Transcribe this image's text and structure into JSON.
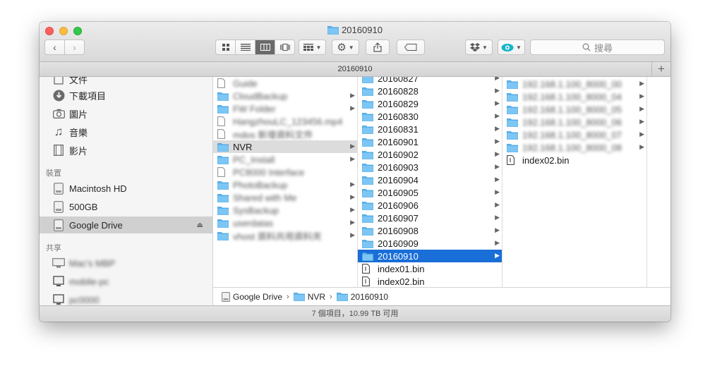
{
  "window": {
    "title": "20160910"
  },
  "toolbar": {
    "search_placeholder": "搜尋"
  },
  "pathbar": {
    "title": "20160910"
  },
  "sidebar": {
    "items_top": [
      {
        "label": "文件",
        "icon": "document-icon"
      },
      {
        "label": "下載項目",
        "icon": "download-icon"
      },
      {
        "label": "圖片",
        "icon": "camera-icon"
      },
      {
        "label": "音樂",
        "icon": "music-note-icon"
      },
      {
        "label": "影片",
        "icon": "film-icon"
      }
    ],
    "devices_header": "裝置",
    "devices": [
      {
        "label": "Macintosh HD",
        "icon": "harddisk-icon"
      },
      {
        "label": "500GB",
        "icon": "harddisk-icon"
      },
      {
        "label": "Google Drive",
        "icon": "harddisk-icon"
      }
    ],
    "shared_header": "共享",
    "shared": [
      {
        "label": "Mac's MBP"
      },
      {
        "label": "mobile-pc"
      },
      {
        "label": "pc0000"
      }
    ]
  },
  "columns": {
    "col1": [
      {
        "label": "Guide",
        "folder": false,
        "arrow": false
      },
      {
        "label": "CloudBackup",
        "folder": true,
        "arrow": true
      },
      {
        "label": "FW Folder",
        "folder": true,
        "arrow": true
      },
      {
        "label": "HangzhouLC_123456.mp4",
        "folder": false,
        "arrow": false
      },
      {
        "label": "mdos 新增資料文件",
        "folder": false,
        "arrow": false
      },
      {
        "label": "NVR",
        "folder": true,
        "arrow": true
      },
      {
        "label": "PC_Install",
        "folder": true,
        "arrow": true
      },
      {
        "label": "PC8000 Interface",
        "folder": false,
        "arrow": false
      },
      {
        "label": "PhotoBackup",
        "folder": true,
        "arrow": true
      },
      {
        "label": "Shared with Me",
        "folder": true,
        "arrow": true
      },
      {
        "label": "SysBackup",
        "folder": true,
        "arrow": true
      },
      {
        "label": "userdatas",
        "folder": true,
        "arrow": true
      },
      {
        "label": "vhost 資料共用資料夾",
        "folder": true,
        "arrow": true
      }
    ],
    "col2": [
      {
        "label": "20160827",
        "folder": true,
        "arrow": true
      },
      {
        "label": "20160828",
        "folder": true,
        "arrow": true
      },
      {
        "label": "20160829",
        "folder": true,
        "arrow": true
      },
      {
        "label": "20160830",
        "folder": true,
        "arrow": true
      },
      {
        "label": "20160831",
        "folder": true,
        "arrow": true
      },
      {
        "label": "20160901",
        "folder": true,
        "arrow": true
      },
      {
        "label": "20160902",
        "folder": true,
        "arrow": true
      },
      {
        "label": "20160903",
        "folder": true,
        "arrow": true
      },
      {
        "label": "20160904",
        "folder": true,
        "arrow": true
      },
      {
        "label": "20160905",
        "folder": true,
        "arrow": true
      },
      {
        "label": "20160906",
        "folder": true,
        "arrow": true
      },
      {
        "label": "20160907",
        "folder": true,
        "arrow": true
      },
      {
        "label": "20160908",
        "folder": true,
        "arrow": true
      },
      {
        "label": "20160909",
        "folder": true,
        "arrow": true
      },
      {
        "label": "20160910",
        "folder": true,
        "arrow": true
      },
      {
        "label": "index01.bin",
        "folder": false,
        "arrow": false
      },
      {
        "label": "index02.bin",
        "folder": false,
        "arrow": false
      }
    ],
    "col3": [
      {
        "label": "192.168.1.100_8000_00",
        "folder": true,
        "arrow": true
      },
      {
        "label": "192.168.1.100_8000_04",
        "folder": true,
        "arrow": true
      },
      {
        "label": "192.168.1.100_8000_05",
        "folder": true,
        "arrow": true
      },
      {
        "label": "192.168.1.100_8000_06",
        "folder": true,
        "arrow": true
      },
      {
        "label": "192.168.1.100_8000_07",
        "folder": true,
        "arrow": true
      },
      {
        "label": "192.168.1.100_8000_08",
        "folder": true,
        "arrow": true
      },
      {
        "label": "index02.bin",
        "folder": false,
        "arrow": false
      }
    ]
  },
  "breadcrumb": [
    {
      "label": "Google Drive",
      "icon": "harddisk-icon"
    },
    {
      "label": "NVR",
      "icon": "folder-icon"
    },
    {
      "label": "20160910",
      "icon": "folder-icon"
    }
  ],
  "status": {
    "text": "7 個項目，10.99 TB 可用"
  },
  "colors": {
    "selection_blue": "#1a6ed8",
    "folder_blue": "#5cb6f0"
  }
}
